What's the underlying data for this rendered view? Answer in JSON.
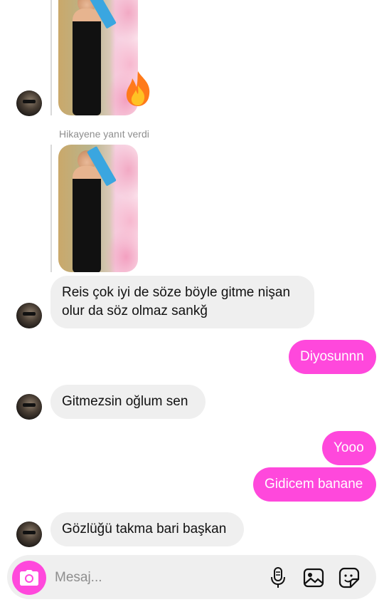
{
  "thread": {
    "story_reply_label": "Hikayene yanıt verdi",
    "fire_emoji": "🔥",
    "messages": [
      {
        "from": "them",
        "text": "Reis çok iyi de söze böyle gitme nişan olur da söz olmaz sankğ"
      },
      {
        "from": "me",
        "text": "Diyosunnn"
      },
      {
        "from": "them",
        "text": "Gitmezsin oğlum sen"
      },
      {
        "from": "me",
        "text": "Yooo"
      },
      {
        "from": "me",
        "text": "Gidicem banane"
      },
      {
        "from": "them",
        "text": "Gözlüğü takma bari başkan"
      }
    ]
  },
  "composer": {
    "placeholder": "Mesaj..."
  },
  "colors": {
    "outgoing_bubble": "#ff48dc",
    "incoming_bubble": "#efefef",
    "camera_button": "#ff48dc"
  },
  "icons": [
    "camera-icon",
    "microphone-icon",
    "gallery-icon",
    "sticker-icon"
  ]
}
